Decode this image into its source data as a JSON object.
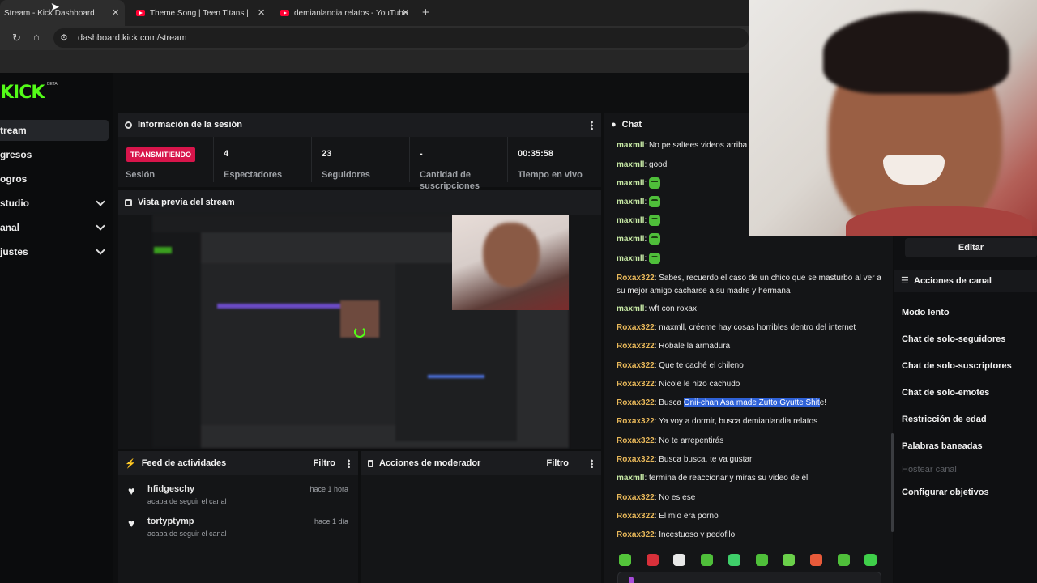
{
  "browser": {
    "tabs": [
      {
        "title": "Stream - Kick Dashboard",
        "active": true
      },
      {
        "title": "Theme Song | Teen Titans | Wa",
        "active": false
      },
      {
        "title": "demianlandia relatos - YouTube",
        "active": false
      }
    ],
    "new_tab": "+",
    "url": "dashboard.kick.com/stream"
  },
  "sidebar": {
    "logo": "KICK",
    "logo_badge": "BETA",
    "items": [
      {
        "label": "tream",
        "expandable": false,
        "active": true
      },
      {
        "label": "gresos",
        "expandable": false,
        "active": false
      },
      {
        "label": "ogros",
        "expandable": false,
        "active": false
      },
      {
        "label": "studio",
        "expandable": true,
        "active": false
      },
      {
        "label": "anal",
        "expandable": true,
        "active": false
      },
      {
        "label": "justes",
        "expandable": true,
        "active": false
      }
    ]
  },
  "session": {
    "title": "Información de la sesión",
    "status_badge": "TRANSMITIENDO",
    "status_label": "Sesión",
    "stats": [
      {
        "value": "4",
        "label": "Espectadores"
      },
      {
        "value": "23",
        "label": "Seguidores"
      },
      {
        "value": "-",
        "label": "Cantidad de suscripciones"
      },
      {
        "value": "00:35:58",
        "label": "Tiempo en vivo"
      }
    ]
  },
  "preview": {
    "title": "Vista previa del stream"
  },
  "activity_feed": {
    "title": "Feed de actividades",
    "filter": "Filtro",
    "items": [
      {
        "user": "hfidgeschy",
        "action": "acaba de seguir el canal",
        "time": "hace 1 hora"
      },
      {
        "user": "tortyptymp",
        "action": "acaba de seguir el canal",
        "time": "hace 1 día"
      }
    ]
  },
  "mod_actions": {
    "title": "Acciones de moderador",
    "filter": "Filtro"
  },
  "chat": {
    "title": "Chat",
    "messages": [
      {
        "user": "maxmll",
        "text": "No pe saltees videos arriba"
      },
      {
        "user": "maxmll",
        "text": "good"
      },
      {
        "user": "maxmll",
        "text": "",
        "emote": true
      },
      {
        "user": "maxmll",
        "text": "",
        "emote": true
      },
      {
        "user": "maxmll",
        "text": "",
        "emote": true
      },
      {
        "user": "maxmll",
        "text": "",
        "emote": true
      },
      {
        "user": "maxmll",
        "text": "",
        "emote": true
      },
      {
        "user": "Roxax322",
        "text": "Sabes, recuerdo el caso de un chico que se masturbo al ver a su mejor amigo cacharse a su madre y hermana"
      },
      {
        "user": "maxmll",
        "text": "wft con roxax"
      },
      {
        "user": "Roxax322",
        "text": "maxmll, créeme hay cosas horribles dentro del internet"
      },
      {
        "user": "Roxax322",
        "text": "Robale la armadura"
      },
      {
        "user": "Roxax322",
        "text": "Que te caché el chileno"
      },
      {
        "user": "Roxax322",
        "text": "Nicole le hizo cachudo"
      },
      {
        "user": "Roxax322",
        "text": "Busca ",
        "highlight": "Onii-chan Asa made Zutto Gyutte Shit",
        "after": "e!"
      },
      {
        "user": "Roxax322",
        "text": "Ya voy a dormir, busca demianlandia relatos"
      },
      {
        "user": "Roxax322",
        "text": "No te arrepentirás"
      },
      {
        "user": "Roxax322",
        "text": "Busca busca, te va gustar"
      },
      {
        "user": "maxmll",
        "text": "termina de reaccionar y miras su video de él"
      },
      {
        "user": "Roxax322",
        "text": "No es ese"
      },
      {
        "user": "Roxax322",
        "text": "El mio era porno"
      },
      {
        "user": "Roxax322",
        "text": "Incestuoso y pedofilo"
      }
    ]
  },
  "channel_actions": {
    "edit_button": "Editar",
    "title": "Acciones de canal",
    "items": [
      {
        "label": "Modo lento",
        "disabled": false
      },
      {
        "label": "Chat de solo-seguidores",
        "disabled": false
      },
      {
        "label": "Chat de solo-suscriptores",
        "disabled": false
      },
      {
        "label": "Chat de solo-emotes",
        "disabled": false
      },
      {
        "label": "Restricción de edad",
        "disabled": false
      },
      {
        "label": "Palabras baneadas",
        "disabled": false
      },
      {
        "label": "Hostear canal",
        "disabled": true
      },
      {
        "label": "Configurar objetivos",
        "disabled": false
      }
    ]
  },
  "colors": {
    "brand": "#53fc18",
    "live": "#d8154b",
    "highlight": "#2f62d8"
  }
}
